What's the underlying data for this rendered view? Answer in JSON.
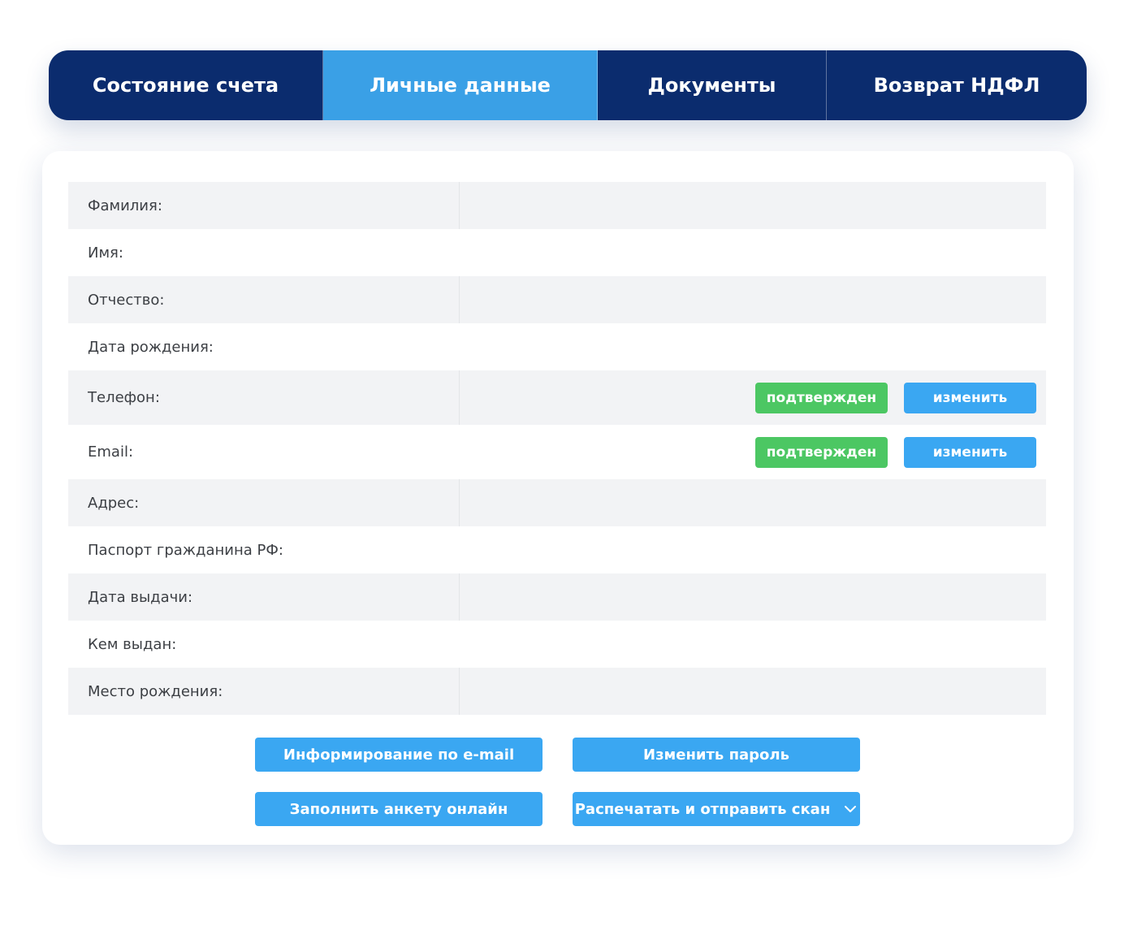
{
  "tabs": [
    {
      "label": "Состояние счета",
      "active": false
    },
    {
      "label": "Личные данные",
      "active": true
    },
    {
      "label": "Документы",
      "active": false
    },
    {
      "label": "Возврат НДФЛ",
      "active": false
    }
  ],
  "form": {
    "rows": [
      {
        "label": "Фамилия:",
        "value": ""
      },
      {
        "label": "Имя:",
        "value": ""
      },
      {
        "label": "Отчество:",
        "value": ""
      },
      {
        "label": "Дата рождения:",
        "value": ""
      },
      {
        "label": "Телефон:",
        "value": "",
        "status": "подтвержден",
        "action": "изменить"
      },
      {
        "label": "Email:",
        "value": "",
        "status": "подтвержден",
        "action": "изменить"
      },
      {
        "label": "Адрес:",
        "value": ""
      },
      {
        "label": "Паспорт гражданина РФ:",
        "value": ""
      },
      {
        "label": "Дата выдачи:",
        "value": ""
      },
      {
        "label": "Кем выдан:",
        "value": ""
      },
      {
        "label": "Место рождения:",
        "value": ""
      }
    ]
  },
  "buttons": {
    "email_info": "Информирование по e-mail",
    "change_password": "Изменить пароль",
    "fill_online": "Заполнить анкету онлайн",
    "print_send": "Распечатать и отправить скан"
  },
  "colors": {
    "tab_bar": "#0b2c6e",
    "tab_active": "#3aa0e6",
    "button_blue": "#3aa7f2",
    "badge_green": "#4cc763",
    "row_stripe": "#f2f3f5"
  }
}
